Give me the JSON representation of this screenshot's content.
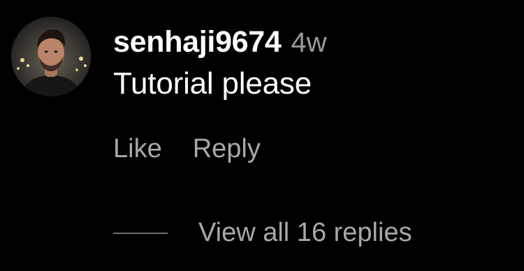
{
  "comment": {
    "avatar": {
      "icon": "user-avatar-photo"
    },
    "username": "senhaji9674",
    "timestamp": "4w",
    "text": "Tutorial please",
    "actions": {
      "like_label": "Like",
      "reply_label": "Reply"
    },
    "replies": {
      "view_label": "View all 16 replies"
    }
  },
  "colors": {
    "background": "#000000",
    "primary_text": "#ffffff",
    "secondary_text": "#a8a8a8",
    "timestamp": "#9a9a9a",
    "divider": "#6e6e6e"
  }
}
